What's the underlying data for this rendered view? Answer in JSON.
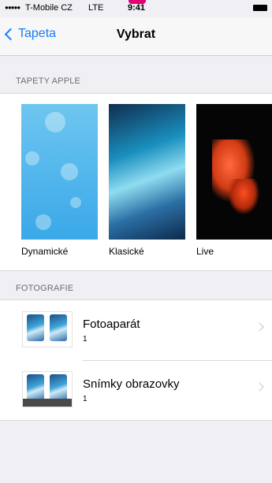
{
  "status_bar": {
    "signal": "●●●●●",
    "carrier": "T-Mobile CZ",
    "network": "LTE",
    "time": "9:41"
  },
  "nav": {
    "back_label": "Tapeta",
    "title": "Vybrat"
  },
  "apple_wallpapers": {
    "header": "TAPETY APPLE",
    "items": [
      {
        "label": "Dynamické"
      },
      {
        "label": "Klasické"
      },
      {
        "label": "Live"
      }
    ]
  },
  "photos": {
    "header": "FOTOGRAFIE",
    "albums": [
      {
        "title": "Fotoaparát",
        "count": "1"
      },
      {
        "title": "Snímky obrazovky",
        "count": "1"
      }
    ]
  },
  "colors": {
    "accent": "#147efb",
    "brand": "#e20074"
  }
}
